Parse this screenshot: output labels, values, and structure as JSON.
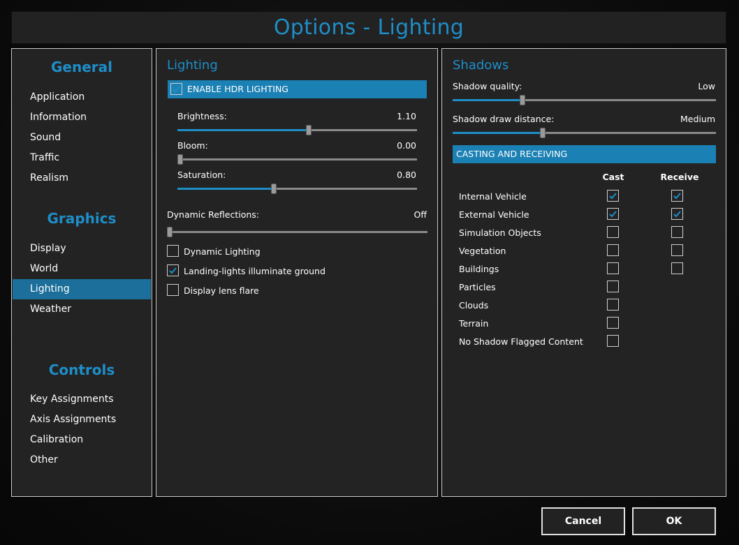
{
  "window": {
    "title": "Options - Lighting"
  },
  "colors": {
    "accent": "#1e8ec9",
    "selected": "#1b6f9a",
    "panel": "#232323"
  },
  "nav": {
    "general": {
      "heading": "General",
      "items": [
        "Application",
        "Information",
        "Sound",
        "Traffic",
        "Realism"
      ]
    },
    "graphics": {
      "heading": "Graphics",
      "items": [
        "Display",
        "World",
        "Lighting",
        "Weather"
      ],
      "active": "Lighting"
    },
    "controls": {
      "heading": "Controls",
      "items": [
        "Key Assignments",
        "Axis Assignments",
        "Calibration",
        "Other"
      ]
    }
  },
  "lighting": {
    "title": "Lighting",
    "hdr": {
      "label": "ENABLE HDR LIGHTING",
      "checked": true
    },
    "sliders": [
      {
        "label": "Brightness:",
        "value": "1.10",
        "fraction": 0.55
      },
      {
        "label": "Bloom:",
        "value": "0.00",
        "fraction": 0.0
      },
      {
        "label": "Saturation:",
        "value": "0.80",
        "fraction": 0.4
      }
    ],
    "reflections": {
      "label": "Dynamic Reflections:",
      "value": "Off",
      "fraction": 0.0
    },
    "checkboxes": [
      {
        "label": "Dynamic Lighting",
        "checked": false
      },
      {
        "label": "Landing-lights illuminate ground",
        "checked": true
      },
      {
        "label": "Display lens flare",
        "checked": false
      }
    ]
  },
  "shadows": {
    "title": "Shadows",
    "quality": {
      "label": "Shadow quality:",
      "value": "Low",
      "fraction": 0.26
    },
    "distance": {
      "label": "Shadow draw distance:",
      "value": "Medium",
      "fraction": 0.34
    },
    "section": "CASTING AND RECEIVING",
    "columns": {
      "cast": "Cast",
      "receive": "Receive"
    },
    "rows": [
      {
        "label": "Internal Vehicle",
        "cast": true,
        "receive": true
      },
      {
        "label": "External Vehicle",
        "cast": true,
        "receive": true
      },
      {
        "label": "Simulation Objects",
        "cast": false,
        "receive": false
      },
      {
        "label": "Vegetation",
        "cast": false,
        "receive": false
      },
      {
        "label": "Buildings",
        "cast": false,
        "receive": false
      },
      {
        "label": "Particles",
        "cast": false
      },
      {
        "label": "Clouds",
        "cast": false
      },
      {
        "label": "Terrain",
        "cast": false
      },
      {
        "label": "No Shadow Flagged Content",
        "cast": false
      }
    ]
  },
  "buttons": {
    "cancel": "Cancel",
    "ok": "OK"
  }
}
